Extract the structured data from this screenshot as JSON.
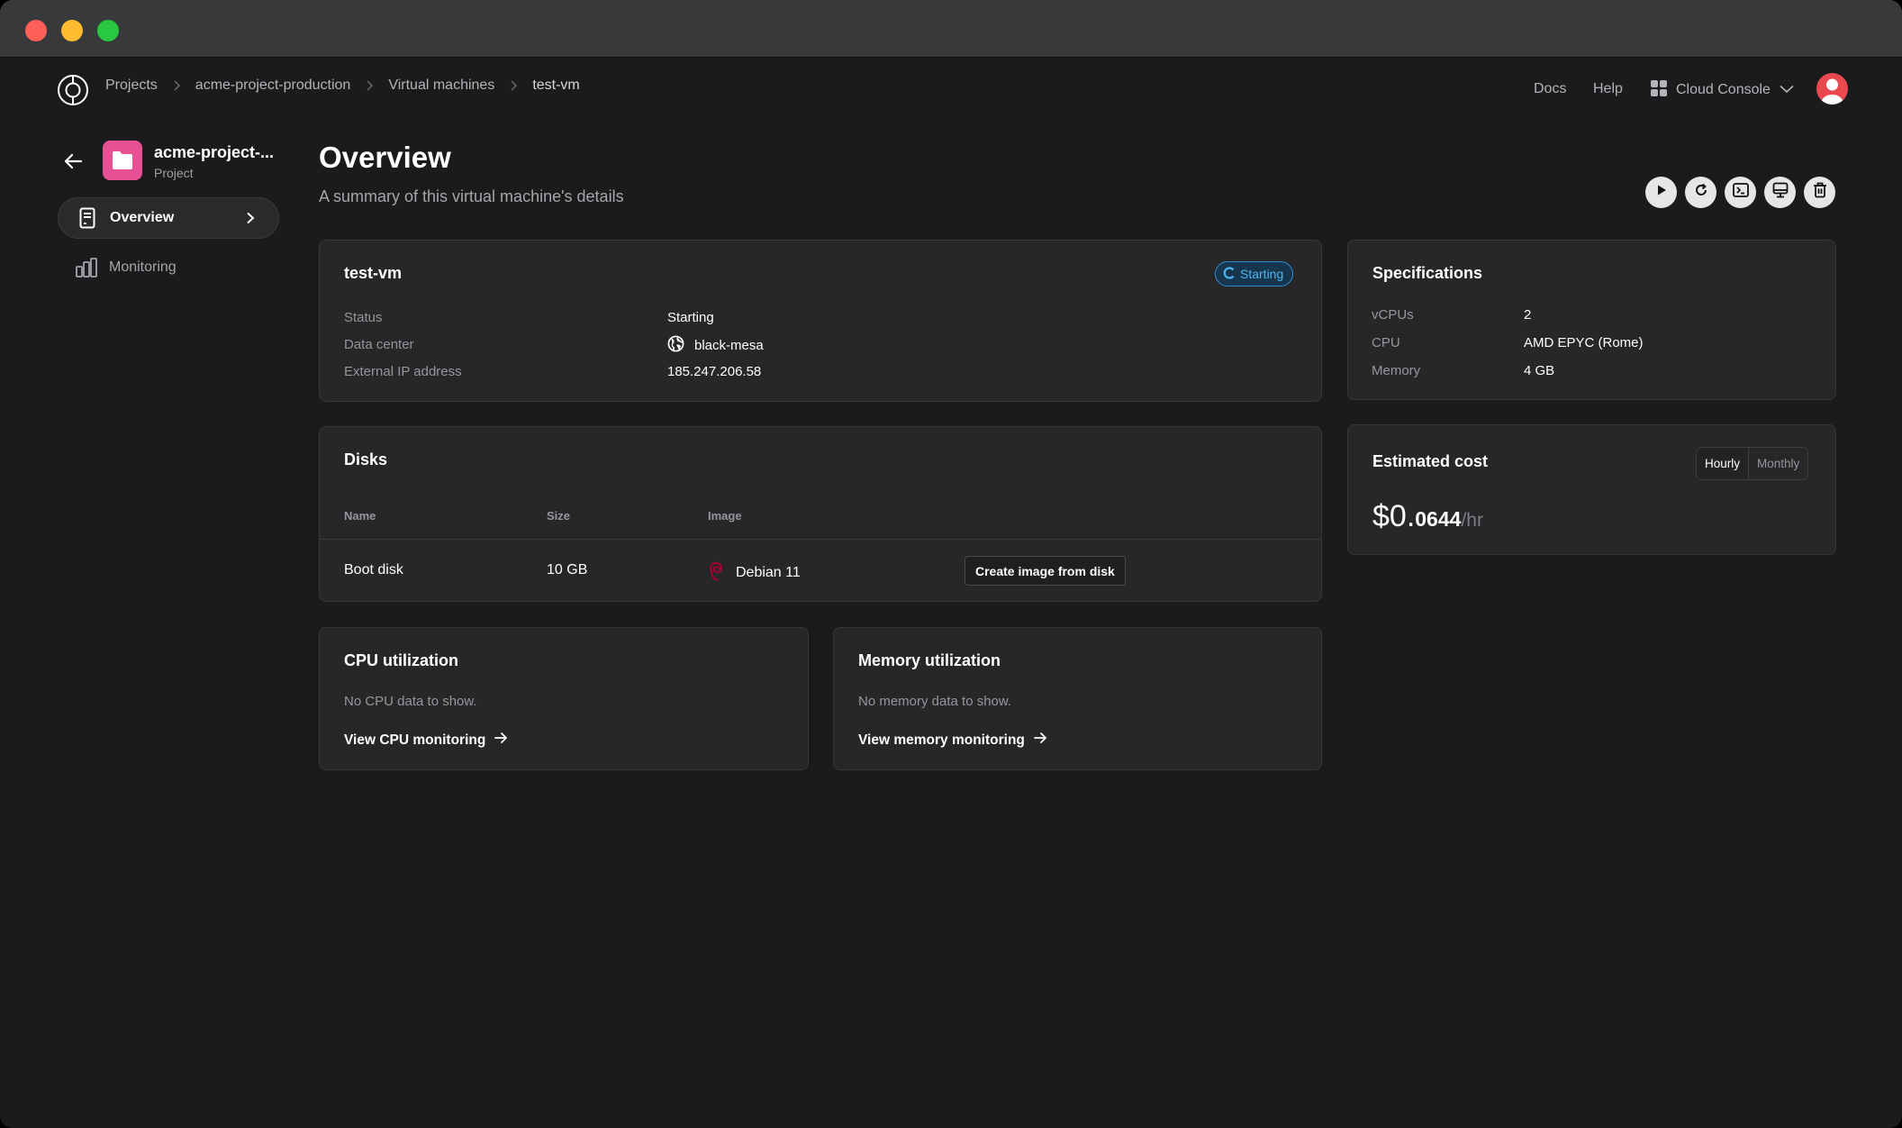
{
  "breadcrumb": [
    "Projects",
    "acme-project-production",
    "Virtual machines",
    "test-vm"
  ],
  "nav": {
    "docs": "Docs",
    "help": "Help",
    "console": "Cloud Console"
  },
  "sidebar": {
    "project_name": "acme-project-...",
    "project_type": "Project",
    "items": [
      {
        "label": "Overview",
        "active": true
      },
      {
        "label": "Monitoring",
        "active": false
      }
    ]
  },
  "header": {
    "title": "Overview",
    "subtitle": "A summary of this virtual machine's details"
  },
  "actions": [
    "start",
    "restart",
    "console",
    "display",
    "delete"
  ],
  "vm": {
    "name": "test-vm",
    "status_badge": "Starting",
    "status_color": "#4fb3ee",
    "fields": [
      {
        "label": "Status",
        "value": "Starting"
      },
      {
        "label": "Data center",
        "value": "black-mesa"
      },
      {
        "label": "External IP address",
        "value": "185.247.206.58"
      }
    ]
  },
  "specs": {
    "title": "Specifications",
    "fields": [
      {
        "label": "vCPUs",
        "value": "2"
      },
      {
        "label": "CPU",
        "value": "AMD EPYC (Rome)"
      },
      {
        "label": "Memory",
        "value": "4 GB"
      }
    ]
  },
  "disks": {
    "title": "Disks",
    "columns": [
      "Name",
      "Size",
      "Image"
    ],
    "rows": [
      {
        "name": "Boot disk",
        "size": "10 GB",
        "image": "Debian 11",
        "action": "Create image from disk"
      }
    ]
  },
  "cost": {
    "title": "Estimated cost",
    "toggle": [
      "Hourly",
      "Monthly"
    ],
    "selected": "Hourly",
    "amount_main": "$0.",
    "amount_decimals": "0644",
    "unit": "/hr"
  },
  "cpu": {
    "title": "CPU utilization",
    "empty": "No CPU data to show.",
    "link": "View CPU monitoring"
  },
  "memory": {
    "title": "Memory utilization",
    "empty": "No memory data to show.",
    "link": "View memory monitoring"
  }
}
